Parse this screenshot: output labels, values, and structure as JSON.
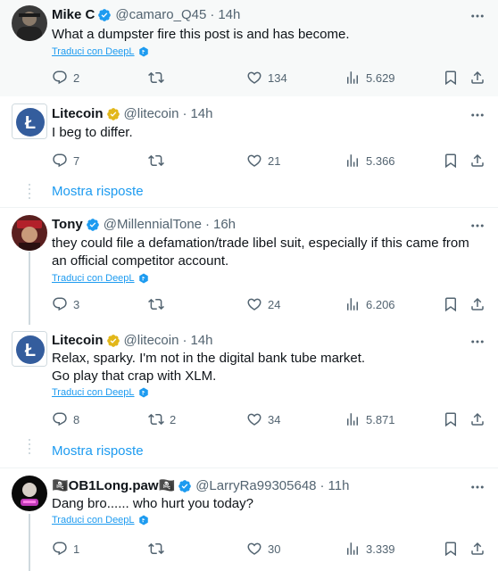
{
  "tweets": [
    {
      "name": "Mike C",
      "badge": "blue",
      "handle": "@camaro_Q45",
      "time": "14h",
      "text": "What a dumpster fire this post is and has become.",
      "translate": "Traduci con DeepL",
      "replies": "2",
      "retweets": "",
      "likes": "134",
      "views": "5.629"
    },
    {
      "name": "Litecoin",
      "badge": "gold",
      "handle": "@litecoin",
      "time": "14h",
      "text": "I beg to differ.",
      "translate": "",
      "replies": "7",
      "retweets": "",
      "likes": "21",
      "views": "5.366"
    },
    {
      "name": "Tony",
      "badge": "blue",
      "handle": "@MillennialTone",
      "time": "16h",
      "text": "they could file a defamation/trade libel suit, especially if this came from an official competitor account.",
      "translate": "Traduci con DeepL",
      "replies": "3",
      "retweets": "",
      "likes": "24",
      "views": "6.206"
    },
    {
      "name": "Litecoin",
      "badge": "gold",
      "handle": "@litecoin",
      "time": "14h",
      "text_line1": "Relax, sparky. I'm not in the digital bank tube market.",
      "text_line2": "Go play that crap with XLM.",
      "translate": "Traduci con DeepL",
      "replies": "8",
      "retweets": "2",
      "likes": "34",
      "views": "5.871"
    },
    {
      "name": "🏴‍☠️OB1Long.paw🏴‍☠️",
      "badge": "blue",
      "handle": "@LarryRa99305648",
      "time": "11h",
      "text": "Dang bro...... who hurt you today?",
      "translate": "Traduci con DeepL",
      "replies": "1",
      "retweets": "",
      "likes": "30",
      "views": "3.339"
    }
  ],
  "show_more_label": "Mostra risposte",
  "dot": "·",
  "colors": {
    "accent": "#1d9bf0",
    "muted": "#536471",
    "gold": "#e2b719",
    "litecoin": "#345d9d"
  },
  "icons": [
    "reply-icon",
    "retweet-icon",
    "like-icon",
    "views-icon",
    "bookmark-icon",
    "share-icon",
    "more-icon",
    "verified-badge-icon",
    "deepl-icon"
  ]
}
